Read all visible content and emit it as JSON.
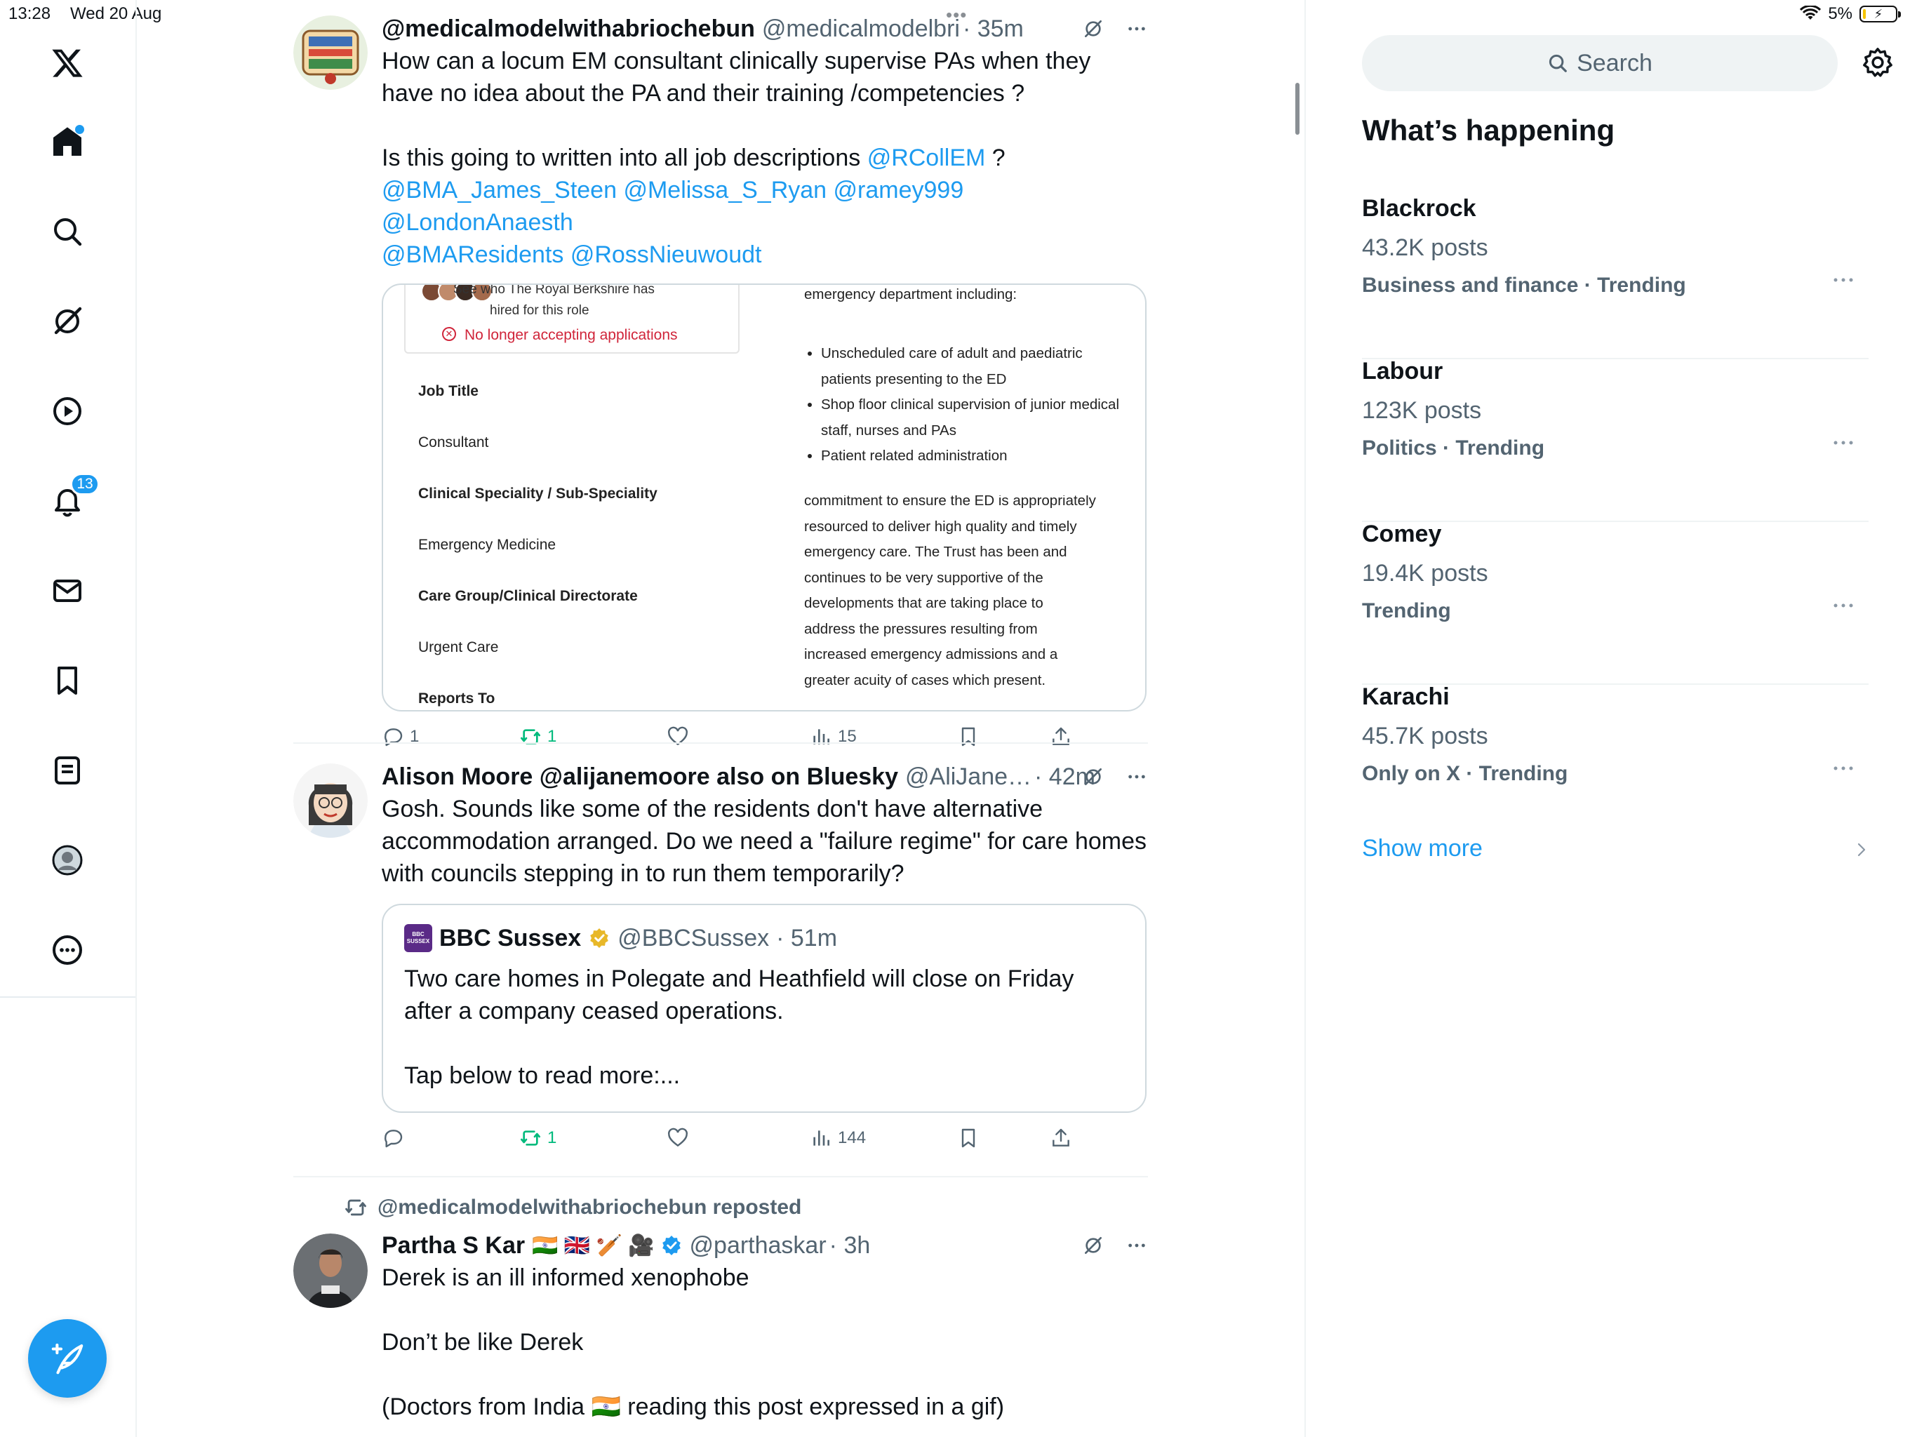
{
  "status_bar": {
    "time": "13:28",
    "date": "Wed 20 Aug",
    "battery": "5%",
    "battery_level": 0.05
  },
  "nav": {
    "items": [
      "x-logo",
      "home",
      "explore",
      "grok",
      "video",
      "notifications",
      "messages",
      "bookmarks",
      "lists",
      "profile",
      "more"
    ],
    "notifications_badge": "13"
  },
  "colors": {
    "accent": "#1d9bf0",
    "repost": "#00ba7c",
    "text": "#0f1419",
    "muted": "#536471",
    "error": "#d0253a"
  },
  "tweets": [
    {
      "name": "@medicalmodelwithabriochebun",
      "handle": "@medicalmodelbri",
      "time": "· 35m",
      "text_1": "How can a locum EM consultant clinically supervise PAs when they\nhave no idea about the PA and their training /competencies ?\n\nIs this going to written into all job descriptions ",
      "mention_1": "@RCollEM",
      "text_2": " ?\n",
      "mentions_2": "@BMA_James_Steen @Melissa_S_Ryan @ramey999 @LondonAnaesth\n@BMAResidents @RossNieuwoudt",
      "media": {
        "card_cut_text": "See who The Royal Berkshire has",
        "card_hired_text": "hired for this role",
        "status": "No longer accepting applications",
        "fields": [
          "Job Title",
          "Consultant",
          "Clinical Speciality / Sub-Speciality",
          "Emergency Medicine",
          "Care Group/Clinical Directorate",
          "Urgent Care",
          "Reports To"
        ],
        "right_top": "emergency department including:",
        "bullets": [
          "Unscheduled care of adult and paediatric patients presenting to the ED",
          "Shop floor clinical supervision of junior medical staff, nurses and PAs",
          "Patient related administration"
        ],
        "right_bottom": "commitment to ensure the ED is appropriately\nresourced to deliver high quality and timely\nemergency care. The Trust has been and\ncontinues to be very supportive of the\ndevelopments that are taking place to\naddress the pressures resulting from\nincreased emergency admissions and a\ngreater acuity of cases which present."
      },
      "replies": "1",
      "reposts": "1",
      "views": "15"
    },
    {
      "name": "Alison Moore @alijanemoore also on Bluesky",
      "handle": "@AliJane…",
      "time": "· 42m",
      "text": "Gosh. Sounds like some of the residents don't have alternative\naccommodation arranged. Do we need a \"failure regime\" for care homes\nwith councils stepping in to run them temporarily?",
      "quote": {
        "logo_text_1": "BBC",
        "logo_text_2": "SUSSEX",
        "name": "BBC Sussex",
        "handle": "@BBCSussex",
        "time": "· 51m",
        "text": "Two care homes in Polegate and Heathfield will close on Friday\nafter a company ceased operations.\n\nTap below to read more:..."
      },
      "replies": "",
      "reposts": "1",
      "views": "144"
    },
    {
      "repost_label": "@medicalmodelwithabriochebun reposted",
      "name": "Partha S Kar",
      "flags": "🇮🇳 🇬🇧 🏏 🎥",
      "handle": "@parthaskar",
      "time": "· 3h",
      "text": "Derek is an ill informed xenophobe\n\nDon’t be like Derek\n\n(Doctors from India 🇮🇳 reading this post expressed in a gif)"
    }
  ],
  "sidebar": {
    "search_placeholder": "Search",
    "title": "What’s happening",
    "trends": [
      {
        "name": "Blackrock",
        "posts": "43.2K posts",
        "category": "Business and finance · Trending"
      },
      {
        "name": "Labour",
        "posts": "123K posts",
        "category": "Politics · Trending"
      },
      {
        "name": "Comey",
        "posts": "19.4K posts",
        "category": "Trending"
      },
      {
        "name": "Karachi",
        "posts": "45.7K posts",
        "category": "Only on X · Trending"
      }
    ],
    "show_more": "Show more"
  }
}
